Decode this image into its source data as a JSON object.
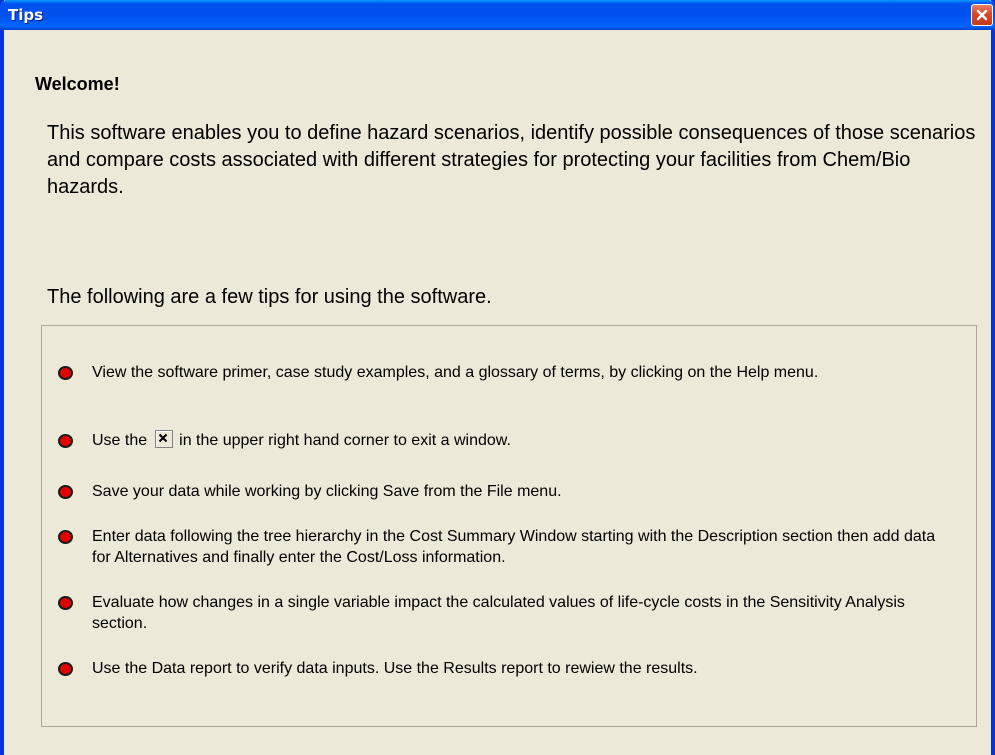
{
  "window": {
    "title": "Tips"
  },
  "welcome": "Welcome!",
  "intro": "This software enables you to define hazard scenarios, identify possible consequences of those scenarios and compare costs associated with different strategies for protecting your facilities from Chem/Bio hazards.",
  "following": "The following are a few tips for using the software.",
  "tips": [
    {
      "text": "View the software primer, case study examples, and a glossary of terms, by clicking on the Help menu."
    },
    {
      "text_before": "Use the",
      "text_after": "in the upper right hand corner to exit a window.",
      "icon": "close-icon"
    },
    {
      "text": "Save your data while working by clicking Save from the File menu."
    },
    {
      "text": "Enter data following the tree hierarchy in the Cost Summary Window starting with the Description section then add data for Alternatives and finally enter the Cost/Loss information."
    },
    {
      "text": "Evaluate how changes in a single variable impact the calculated values of life-cycle costs in the Sensitivity Analysis section."
    },
    {
      "text": "Use the Data report to verify data inputs.  Use the Results report to rewiew the results."
    }
  ],
  "colors": {
    "titlebar": "#0055EA",
    "close_button": "#D8462A",
    "bullet": "#E30000",
    "window_bg": "#ECE9D8"
  }
}
